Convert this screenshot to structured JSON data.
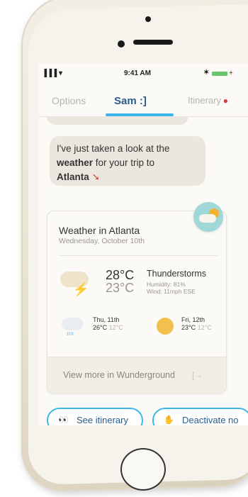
{
  "status_bar": {
    "signal": "▐▐▐ ▾",
    "time": "9:41 AM",
    "bluetooth": "✶"
  },
  "tabs": [
    {
      "label": "Options"
    },
    {
      "label": "Sam :]"
    },
    {
      "label": "Itinerary"
    }
  ],
  "bot_message": {
    "line1": "I've just taken a look at the",
    "weather_word": "weather",
    "line2_rest": " for your trip to",
    "city": "Atlanta"
  },
  "weather_card": {
    "title": "Weather in Atlanta",
    "date": "Wednesday, October 10th",
    "today": {
      "high": "28°C",
      "low": "23°C",
      "condition": "Thunderstorms",
      "humidity": "Humidity: 81%",
      "wind": "Wind: 11mph ESE"
    },
    "forecast": [
      {
        "day": "Thu, 11th",
        "high": "26°C",
        "low": "12°C"
      },
      {
        "day": "Fri, 12th",
        "high": "23°C",
        "low": "12°C"
      }
    ],
    "footer_link": "View more in Wunderground",
    "footer_icon": "external-arrow-icon"
  },
  "actions": [
    {
      "label": "See itinerary",
      "icon": "eyes-icon"
    },
    {
      "label": "Deactivate no",
      "icon": "hand-icon"
    }
  ],
  "colors": {
    "accent": "#3cb6e8",
    "active_tab": "#2a5d8c",
    "alert_dot": "#d43d3d",
    "bubble_bg": "#ece7de"
  }
}
